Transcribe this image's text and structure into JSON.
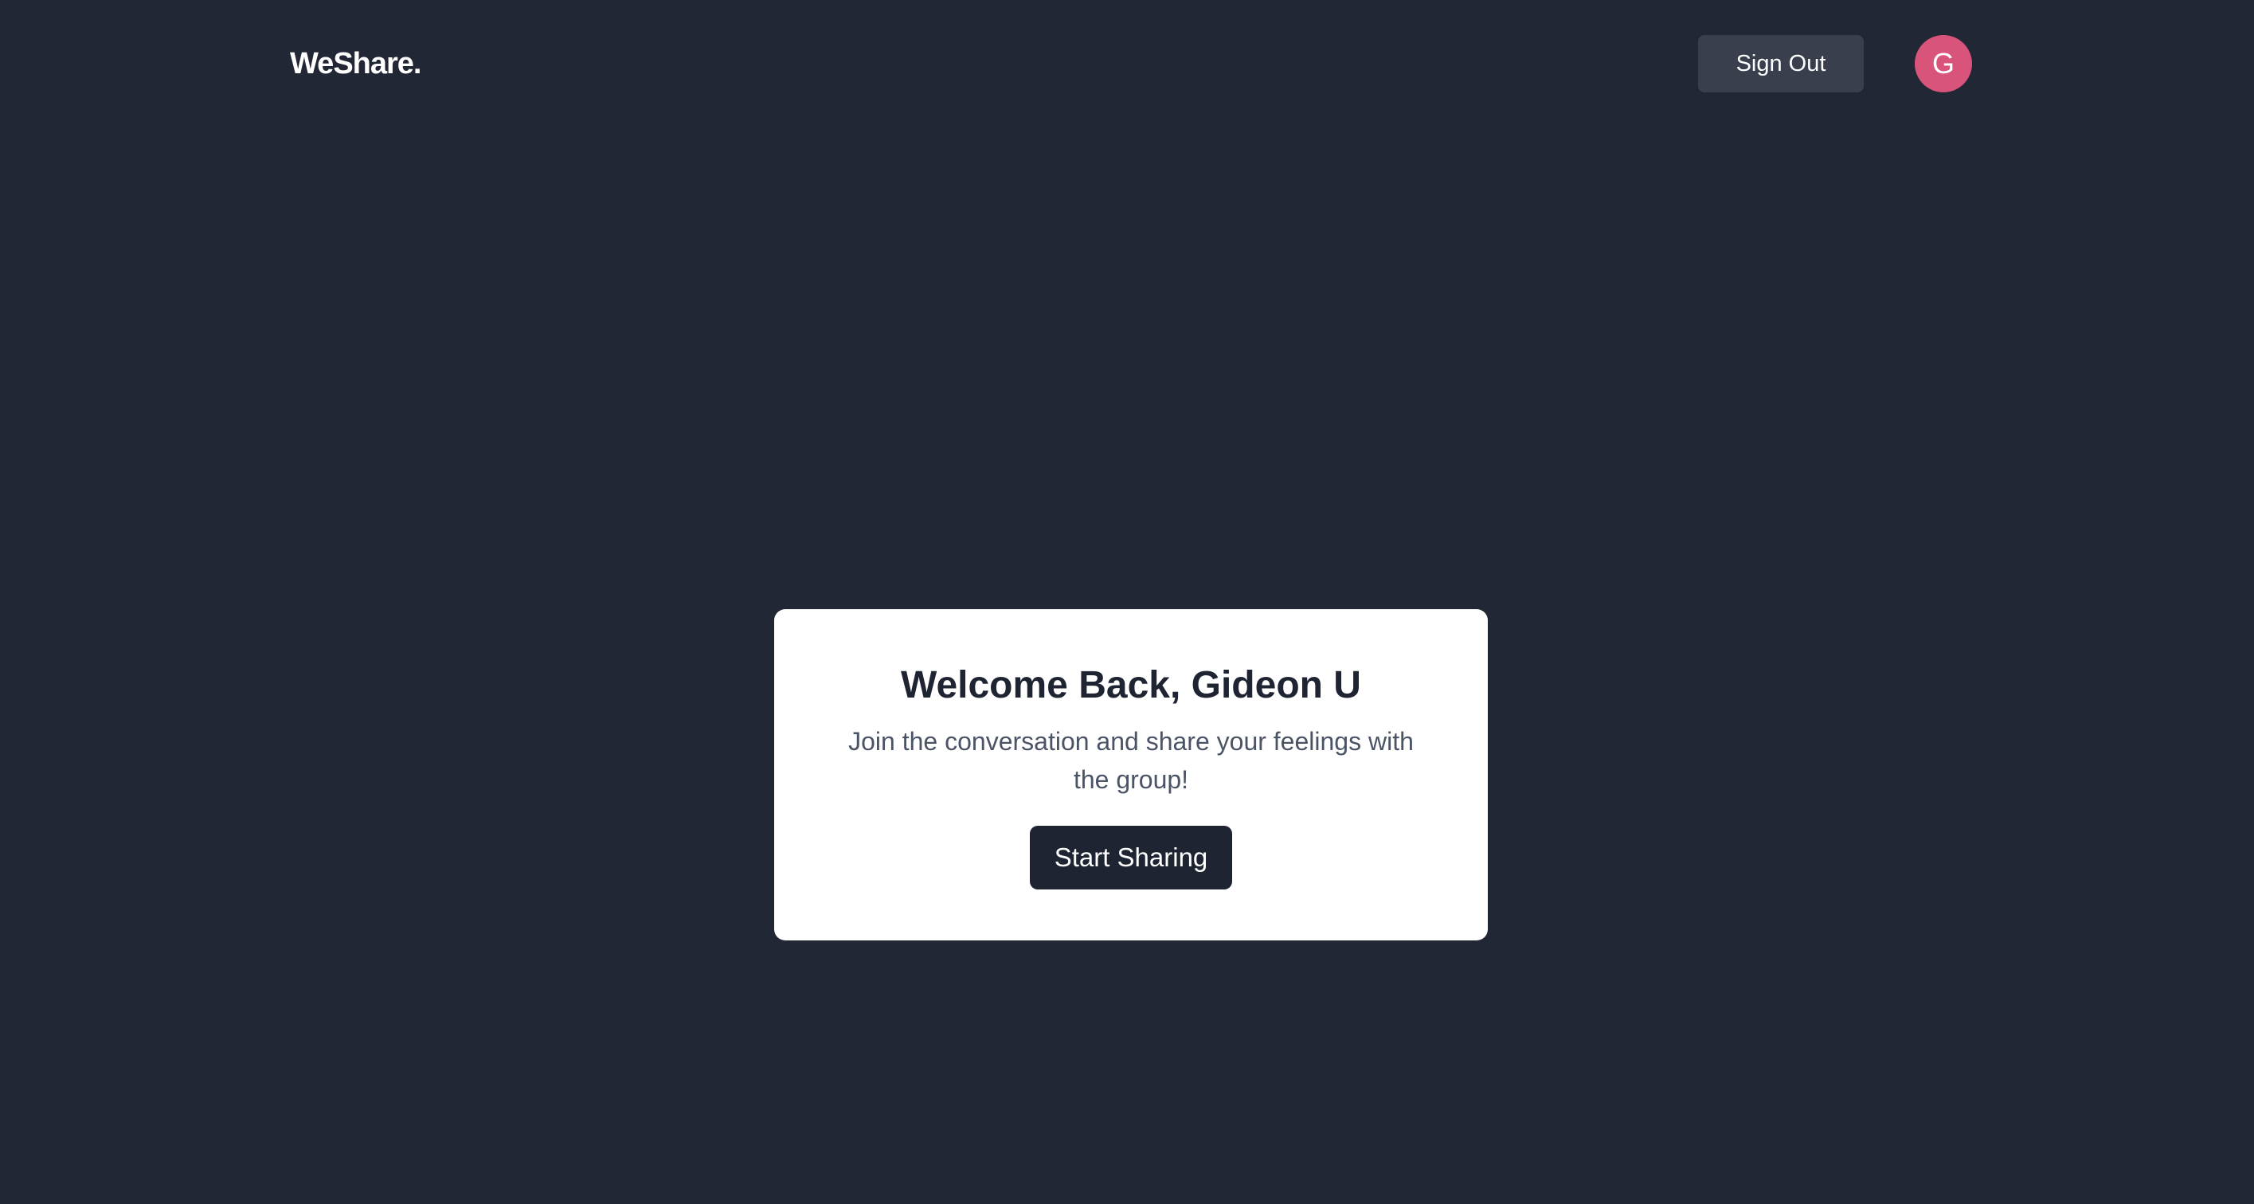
{
  "header": {
    "logo": "WeShare.",
    "sign_out_label": "Sign Out",
    "avatar_initial": "G",
    "avatar_color": "#d9547b"
  },
  "welcome_card": {
    "title": "Welcome Back, Gideon U",
    "subtitle": "Join the conversation and share your feelings with the group!",
    "cta_label": "Start Sharing"
  },
  "colors": {
    "background": "#212735",
    "card": "#ffffff",
    "primary_button": "#1f2432",
    "secondary_button": "#3a3f4e"
  }
}
